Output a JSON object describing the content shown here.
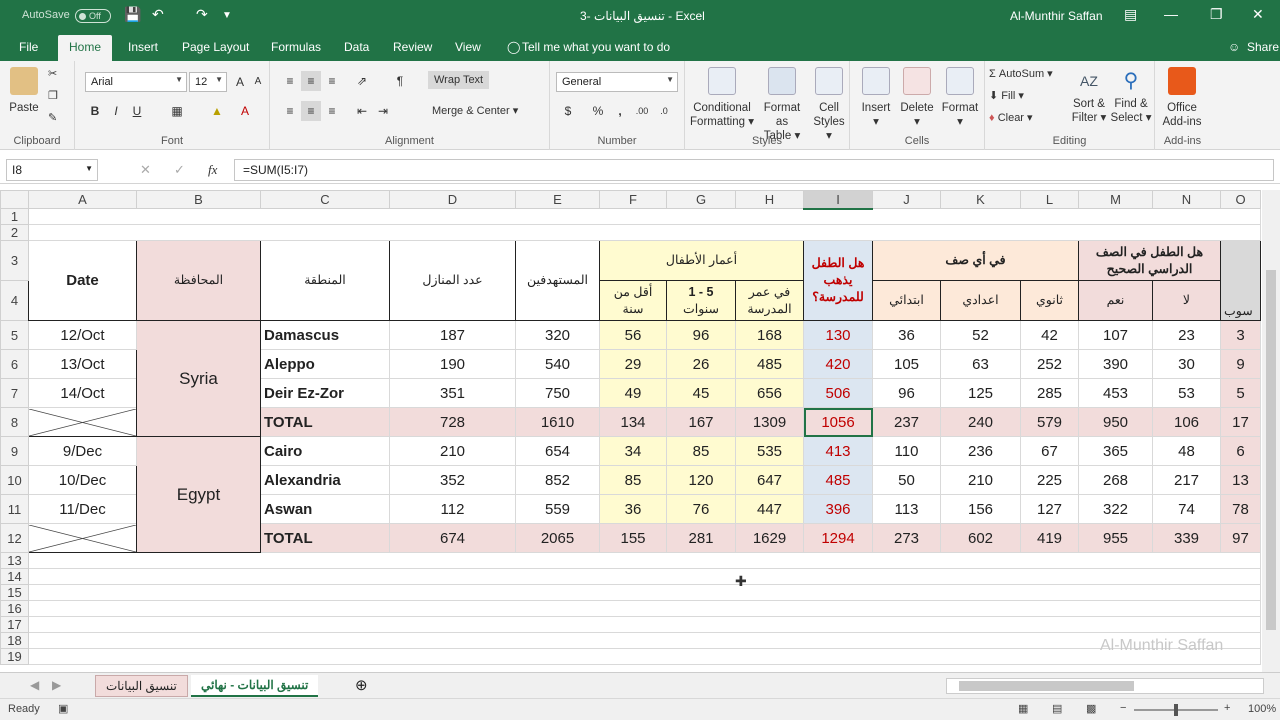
{
  "titlebar": {
    "autosave": "AutoSave",
    "toggle": "Off",
    "title": "3- تنسيق البيانات  -  Excel",
    "user": "Al-Munthir Saffan"
  },
  "menu": {
    "file": "File",
    "home": "Home",
    "insert": "Insert",
    "page_layout": "Page Layout",
    "formulas": "Formulas",
    "data": "Data",
    "review": "Review",
    "view": "View",
    "tell": "Tell me what you want to do",
    "share": "Share"
  },
  "ribbon": {
    "clipboard": {
      "paste": "Paste",
      "label": "Clipboard"
    },
    "font": {
      "name": "Arial",
      "size": "12",
      "label": "Font",
      "bold": "B",
      "italic": "I",
      "underline": "U"
    },
    "alignment": {
      "wrap": "Wrap Text",
      "merge": "Merge & Center",
      "label": "Alignment"
    },
    "number": {
      "format": "General",
      "label": "Number",
      "currency": "$",
      "percent": "%",
      "comma": ","
    },
    "styles": {
      "cond": "Conditional",
      "cond2": "Formatting",
      "format_as": "Format as",
      "table": "Table",
      "cell": "Cell",
      "styles": "Styles",
      "label": "Styles"
    },
    "cells": {
      "insert": "Insert",
      "delete": "Delete",
      "format": "Format",
      "label": "Cells"
    },
    "editing": {
      "autosum": "AutoSum",
      "fill": "Fill",
      "clear": "Clear",
      "sort": "Sort &",
      "filter": "Filter",
      "find": "Find &",
      "select": "Select",
      "label": "Editing"
    },
    "addins": {
      "office": "Office",
      "addins": "Add-ins",
      "label": "Add-ins"
    }
  },
  "formula": {
    "cell": "I8",
    "value": "=SUM(I5:I7)"
  },
  "columns": [
    "A",
    "B",
    "C",
    "D",
    "E",
    "F",
    "G",
    "H",
    "I",
    "J",
    "K",
    "L",
    "M",
    "N",
    "O"
  ],
  "headers": {
    "date": "Date",
    "gov": "المحافظة",
    "region": "المنطقة",
    "houses": "عدد المنازل",
    "target": "المستهدفين",
    "ages": "أعمار الأطفال",
    "under1": "أقل من سنة",
    "age15a": "1 - 5",
    "age15b": "سنوات",
    "school_age": "في عمر المدرسة",
    "goes": "هل الطفل يذهب للمدرسة؟",
    "grade": "في أي صف",
    "primary": "ابتدائي",
    "prep": "اعدادي",
    "secondary": "ثانوي",
    "correct": "هل الطفل في الصف الدراسي الصحيح",
    "yes": "نعم",
    "no": "لا",
    "o4": "سوب"
  },
  "rows": [
    {
      "date": "12/Oct",
      "region": "Damascus",
      "d": "187",
      "e": "320",
      "f": "56",
      "g": "96",
      "h": "168",
      "i": "130",
      "j": "36",
      "k": "52",
      "l": "42",
      "m": "107",
      "n": "23",
      "o": "3"
    },
    {
      "date": "13/Oct",
      "region": "Aleppo",
      "d": "190",
      "e": "540",
      "f": "29",
      "g": "26",
      "h": "485",
      "i": "420",
      "j": "105",
      "k": "63",
      "l": "252",
      "m": "390",
      "n": "30",
      "o": "9"
    },
    {
      "date": "14/Oct",
      "region": "Deir Ez-Zor",
      "d": "351",
      "e": "750",
      "f": "49",
      "g": "45",
      "h": "656",
      "i": "506",
      "j": "96",
      "k": "125",
      "l": "285",
      "m": "453",
      "n": "53",
      "o": "5"
    },
    {
      "date": "",
      "region": "TOTAL",
      "d": "728",
      "e": "1610",
      "f": "134",
      "g": "167",
      "h": "1309",
      "i": "1056",
      "j": "237",
      "k": "240",
      "l": "579",
      "m": "950",
      "n": "106",
      "o": "17"
    },
    {
      "date": "9/Dec",
      "region": "Cairo",
      "d": "210",
      "e": "654",
      "f": "34",
      "g": "85",
      "h": "535",
      "i": "413",
      "j": "110",
      "k": "236",
      "l": "67",
      "m": "365",
      "n": "48",
      "o": "6"
    },
    {
      "date": "10/Dec",
      "region": "Alexandria",
      "d": "352",
      "e": "852",
      "f": "85",
      "g": "120",
      "h": "647",
      "i": "485",
      "j": "50",
      "k": "210",
      "l": "225",
      "m": "268",
      "n": "217",
      "o": "13"
    },
    {
      "date": "11/Dec",
      "region": "Aswan",
      "d": "112",
      "e": "559",
      "f": "36",
      "g": "76",
      "h": "447",
      "i": "396",
      "j": "113",
      "k": "156",
      "l": "127",
      "m": "322",
      "n": "74",
      "o": "78"
    },
    {
      "date": "",
      "region": "TOTAL",
      "d": "674",
      "e": "2065",
      "f": "155",
      "g": "281",
      "h": "1629",
      "i": "1294",
      "j": "273",
      "k": "602",
      "l": "419",
      "m": "955",
      "n": "339",
      "o": "97"
    }
  ],
  "gov": {
    "syria": "Syria",
    "egypt": "Egypt"
  },
  "row_numbers": [
    "1",
    "2",
    "3",
    "4",
    "5",
    "6",
    "7",
    "8",
    "9",
    "10",
    "11",
    "12",
    "13",
    "14",
    "15",
    "16",
    "17",
    "18",
    "19"
  ],
  "tabs": {
    "tab1": "تنسيق البيانات",
    "tab2": "تنسيق البيانات - نهائي"
  },
  "status": {
    "ready": "Ready",
    "zoom": "100%"
  },
  "watermark": "Al-Munthir Saffan"
}
